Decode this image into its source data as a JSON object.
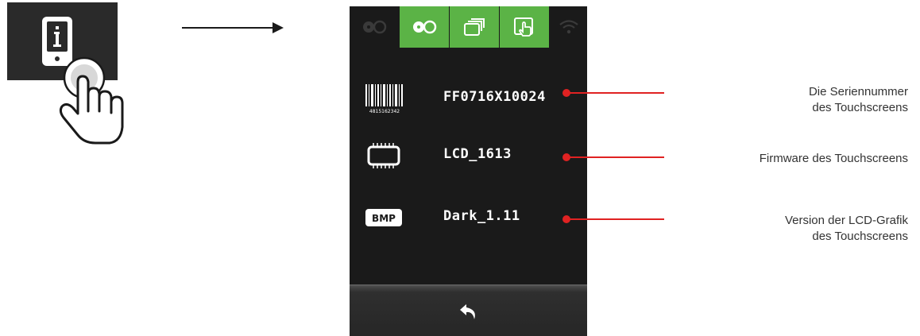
{
  "device": {
    "tabs": [
      {
        "icon": "tape-icon",
        "active": false
      },
      {
        "icon": "tape-icon",
        "active": true
      },
      {
        "icon": "layers-icon",
        "active": true
      },
      {
        "icon": "touch-screen-icon",
        "active": true
      },
      {
        "icon": "wifi-icon",
        "active": false
      }
    ],
    "rows": [
      {
        "icon": "barcode-icon",
        "barcode_digits": "4815162342",
        "value": "FF0716X10024"
      },
      {
        "icon": "chip-icon",
        "value": "LCD_1613"
      },
      {
        "icon": "bmp-icon",
        "badge": "BMP",
        "value": "Dark_1.11"
      }
    ],
    "back_icon": "back-arrow-icon"
  },
  "annotations": {
    "serial": {
      "line1": "Die Seriennummer",
      "line2": "des Touchscreens"
    },
    "firmware": {
      "line1": "Firmware des Touchscreens"
    },
    "graphic": {
      "line1": "Version der LCD-Grafik",
      "line2": "des Touchscreens"
    }
  },
  "colors": {
    "accent": "#5bb346",
    "annotation": "#e02222",
    "screen_bg": "#1a1a1a"
  }
}
